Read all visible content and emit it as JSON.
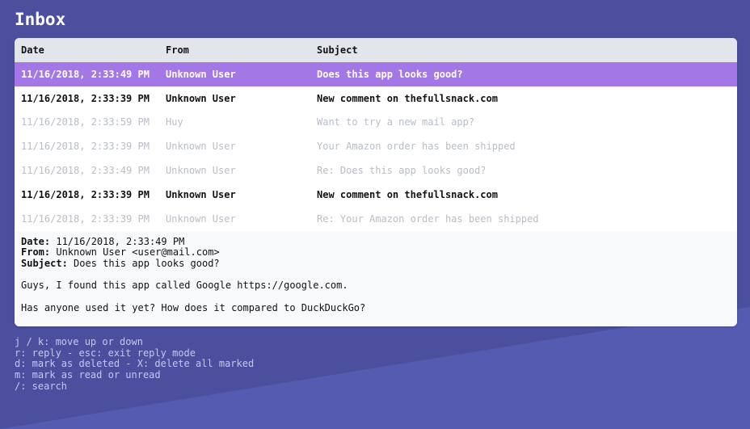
{
  "title": "Inbox",
  "table": {
    "headers": {
      "date": "Date",
      "from": "From",
      "subject": "Subject"
    },
    "rows": [
      {
        "date": "11/16/2018, 2:33:49 PM",
        "from": "Unknown User",
        "subject": "Does this app looks good?",
        "state": "selected"
      },
      {
        "date": "11/16/2018, 2:33:39 PM",
        "from": "Unknown User",
        "subject": "New comment on thefullsnack.com",
        "state": "unread"
      },
      {
        "date": "11/16/2018, 2:33:59 PM",
        "from": "Huy",
        "subject": "Want to try a new mail app?",
        "state": "read"
      },
      {
        "date": "11/16/2018, 2:33:39 PM",
        "from": "Unknown User",
        "subject": "Your Amazon order has been shipped",
        "state": "read"
      },
      {
        "date": "11/16/2018, 2:33:49 PM",
        "from": "Unknown User",
        "subject": "Re: Does this app looks good?",
        "state": "read"
      },
      {
        "date": "11/16/2018, 2:33:39 PM",
        "from": "Unknown User",
        "subject": "New comment on thefullsnack.com",
        "state": "unread"
      },
      {
        "date": "11/16/2018, 2:33:39 PM",
        "from": "Unknown User",
        "subject": "Re: Your Amazon order has been shipped",
        "state": "read"
      }
    ]
  },
  "preview": {
    "date_label": "Date:",
    "date_value": " 11/16/2018, 2:33:49 PM",
    "from_label": "From:",
    "from_value": " Unknown User <user@mail.com>",
    "subject_label": "Subject:",
    "subject_value": " Does this app looks good?",
    "body": [
      "Guys, I found this app called Google https://google.com.",
      "Has anyone used it yet? How does it compared to DuckDuckGo?"
    ]
  },
  "shortcuts": [
    "j / k: move up or down",
    "r: reply - esc: exit reply mode",
    "d: mark as deleted - X: delete all marked",
    "m: mark as read or unread",
    "/: search"
  ],
  "colors": {
    "background": "#5056a8",
    "selected_row": "#a378e6",
    "header_row": "#e2e6ea",
    "read_text": "#b8bdc6",
    "shortcut_text": "#c4c8f4"
  }
}
